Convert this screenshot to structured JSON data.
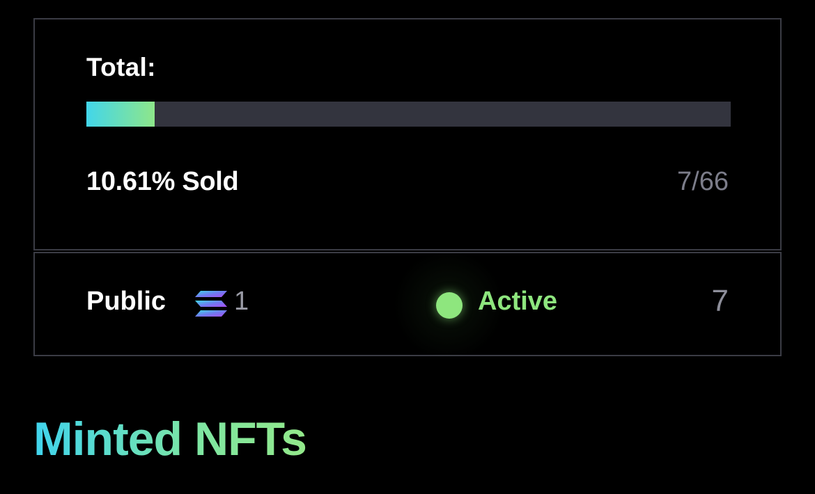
{
  "total": {
    "label": "Total:",
    "progress_fraction": 0.1061,
    "sold_text": "10.61% Sold",
    "count_text": "7/66"
  },
  "phase": {
    "name": "Public",
    "currency_icon": "solana-icon",
    "price": "1",
    "status": "Active",
    "count": "7"
  },
  "minted": {
    "heading": "Minted NFTs"
  },
  "colors": {
    "background": "#000000",
    "border": "#3b3c45",
    "track": "#33343e",
    "accent_cyan": "#42d6ea",
    "accent_green": "#8ee67e",
    "muted_text": "#7c7d8a"
  }
}
